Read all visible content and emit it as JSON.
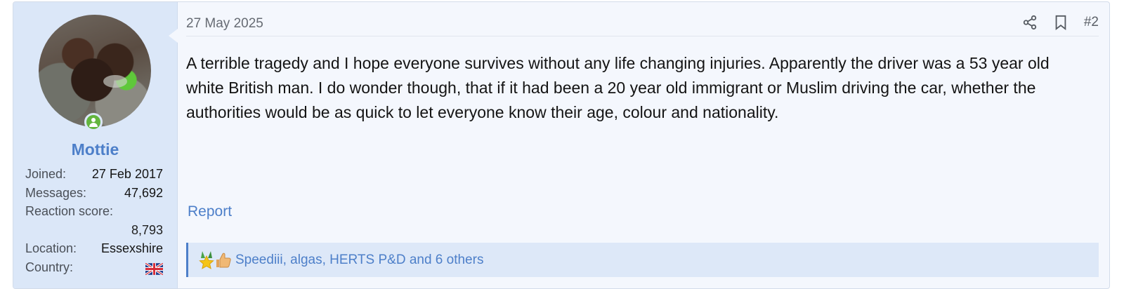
{
  "post": {
    "user": {
      "name": "Mottie",
      "status_icon": "online-user-icon",
      "avatar_icon": "dog-avatar",
      "stats": {
        "joined_label": "Joined:",
        "joined_value": "27 Feb 2017",
        "messages_label": "Messages:",
        "messages_value": "47,692",
        "reaction_label": "Reaction score:",
        "reaction_value": "8,793",
        "location_label": "Location:",
        "location_value": "Essexshire",
        "country_label": "Country:",
        "country_icon": "uk-flag-icon"
      }
    },
    "date": "27 May 2025",
    "actions": {
      "share_icon": "share-icon",
      "bookmark_icon": "bookmark-icon",
      "post_number": "#2"
    },
    "message": "A terrible tragedy and I hope everyone survives without any life changing injuries. Apparently the driver was a 53 year old white British man. I do wonder though, that if it had been a 20 year old immigrant or Muslim driving the car, whether the authorities would be as quick to let everyone know their age, colour and nationality.",
    "report_label": "Report",
    "reactions": {
      "icons": [
        "winner-icon",
        "thumbs-up-icon"
      ],
      "text": "Speediii, algas, HERTS P&D and 6 others"
    }
  },
  "colors": {
    "accent": "#4d7fc9",
    "online": "#63b53e",
    "user_panel": "#dbe7f8",
    "post_bg": "#f4f7fd"
  }
}
